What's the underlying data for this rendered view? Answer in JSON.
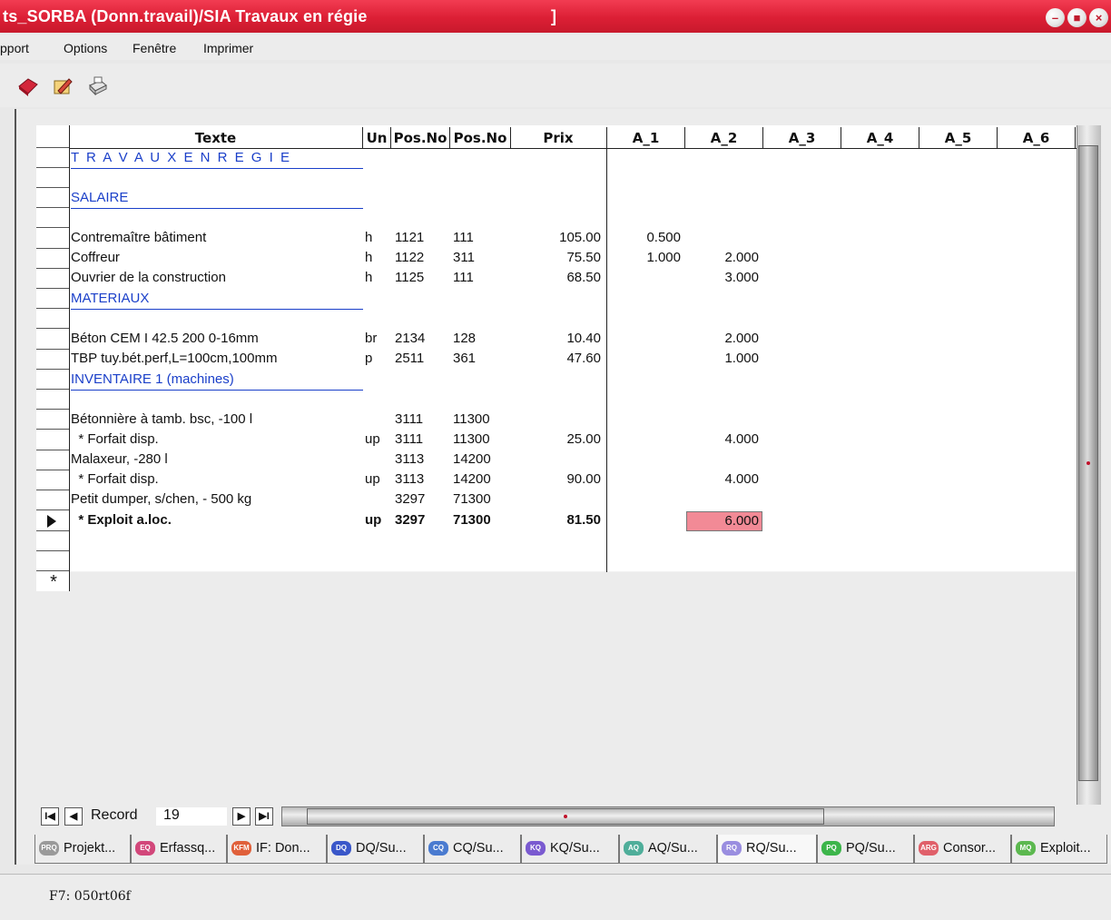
{
  "window": {
    "title": "ts_SORBA (Donn.travail)/SIA Travaux en régie",
    "title_suffix": "]"
  },
  "menu": {
    "items": [
      {
        "label": "pport",
        "underline": ""
      },
      {
        "label": "Options",
        "underline": "p"
      },
      {
        "label": "Fenêtre",
        "underline": "F"
      },
      {
        "label": "Imprimer",
        "underline": "m"
      }
    ]
  },
  "toolbar": {
    "icons": [
      "book-icon",
      "edit-icon",
      "print-icon"
    ]
  },
  "grid": {
    "headers": {
      "texte": "Texte",
      "un": "Un",
      "posno1": "Pos.No",
      "posno2": "Pos.No",
      "prix": "Prix",
      "a1": "A_1",
      "a2": "A_2",
      "a3": "A_3",
      "a4": "A_4",
      "a5": "A_5",
      "a6": "A_6"
    },
    "sections": [
      {
        "label": "T R A V A U X   E N   R E G I E"
      },
      {
        "label": "SALAIRE"
      },
      {
        "label": "MATERIAUX"
      },
      {
        "label": "INVENTAIRE 1 (machines)"
      }
    ],
    "rows": [
      {
        "texte": "Contremaître bâtiment",
        "un": "h",
        "pos1": "1121",
        "pos2": "111",
        "prix": "105.00",
        "a1": "0.500",
        "a2": ""
      },
      {
        "texte": "Coffreur",
        "un": "h",
        "pos1": "1122",
        "pos2": "311",
        "prix": "75.50",
        "a1": "1.000",
        "a2": "2.000"
      },
      {
        "texte": "Ouvrier de la construction",
        "un": "h",
        "pos1": "1125",
        "pos2": "111",
        "prix": "68.50",
        "a1": "",
        "a2": "3.000"
      },
      {
        "texte": "Béton CEM I 42.5 200 0-16mm",
        "un": "br",
        "pos1": "2134",
        "pos2": "128",
        "prix": "10.40",
        "a1": "",
        "a2": "2.000"
      },
      {
        "texte": "TBP tuy.bét.perf,L=100cm,100mm",
        "un": "p",
        "pos1": "2511",
        "pos2": "361",
        "prix": "47.60",
        "a1": "",
        "a2": "1.000"
      },
      {
        "texte": "Bétonnière à tamb. bsc, -100 l",
        "un": "",
        "pos1": "3111",
        "pos2": "11300",
        "prix": "",
        "a1": "",
        "a2": ""
      },
      {
        "texte": "  * Forfait disp.",
        "un": "up",
        "pos1": "3111",
        "pos2": "11300",
        "prix": "25.00",
        "a1": "",
        "a2": "4.000"
      },
      {
        "texte": "Malaxeur, -280 l",
        "un": "",
        "pos1": "3113",
        "pos2": "14200",
        "prix": "",
        "a1": "",
        "a2": ""
      },
      {
        "texte": "  * Forfait disp.",
        "un": "up",
        "pos1": "3113",
        "pos2": "14200",
        "prix": "90.00",
        "a1": "",
        "a2": "4.000"
      },
      {
        "texte": "Petit dumper, s/chen, - 500 kg",
        "un": "",
        "pos1": "3297",
        "pos2": "71300",
        "prix": "",
        "a1": "",
        "a2": ""
      },
      {
        "texte": "  * Exploit a.loc.",
        "un": "up",
        "pos1": "3297",
        "pos2": "71300",
        "prix": "81.50",
        "a1": "",
        "a2": "6.000"
      }
    ],
    "new_row_marker": "*",
    "current_row_marker": "▶"
  },
  "navigator": {
    "label": "Record",
    "value": "19",
    "first": "I◀",
    "prev": "◀",
    "next": "▶",
    "last": "▶I"
  },
  "tabs": [
    {
      "icon_text": "PRQ",
      "label": "Projekt...",
      "color": "#9a9a9a"
    },
    {
      "icon_text": "EQ",
      "label": "Erfassq...",
      "color": "#d2477a"
    },
    {
      "icon_text": "KFM",
      "label": "IF: Don...",
      "color": "#e0603a"
    },
    {
      "icon_text": "DQ",
      "label": "DQ/Su...",
      "color": "#3a57c9"
    },
    {
      "icon_text": "CQ",
      "label": "CQ/Su...",
      "color": "#4a7bd0"
    },
    {
      "icon_text": "KQ",
      "label": "KQ/Su...",
      "color": "#7a5ad0"
    },
    {
      "icon_text": "AQ",
      "label": "AQ/Su...",
      "color": "#4fae9a"
    },
    {
      "icon_text": "RQ",
      "label": "RQ/Su...",
      "color": "#9a8ee0"
    },
    {
      "icon_text": "PQ",
      "label": "PQ/Su...",
      "color": "#3cb54a"
    },
    {
      "icon_text": "ARG",
      "label": "Consor...",
      "color": "#e0606a"
    },
    {
      "icon_text": "MQ",
      "label": "Exploit...",
      "color": "#5cb84f"
    }
  ],
  "status": {
    "text": "F7: 050rt06f"
  }
}
